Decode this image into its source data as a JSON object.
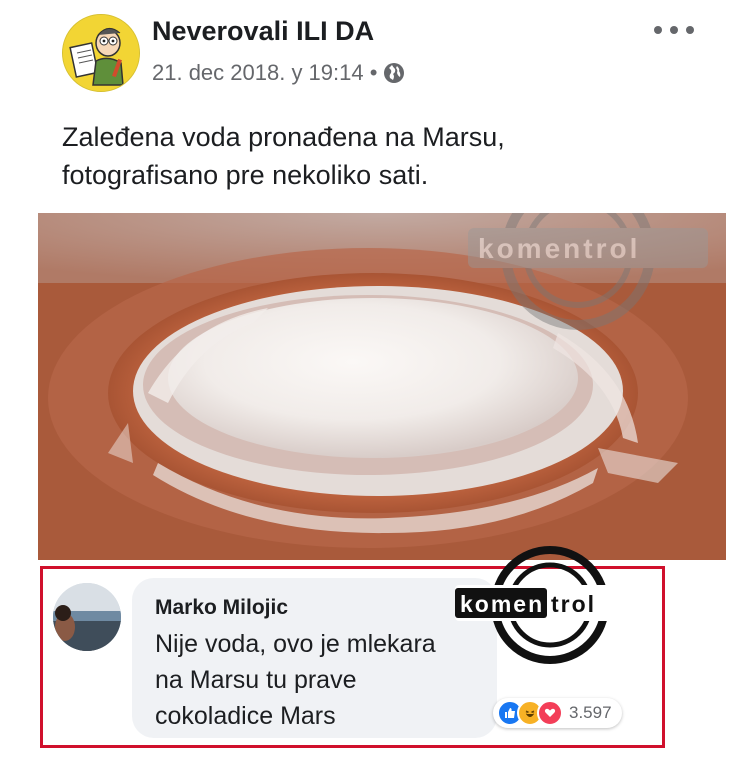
{
  "post": {
    "page_name": "Neverovali ILI DA",
    "timestamp": "21. dec 2018. у 19:14 •",
    "text_line1": "Zaleđena voda pronađena na Marsu,",
    "text_line2": "fotografisano pre nekoliko sati."
  },
  "watermark": {
    "brand": "komentrol"
  },
  "comment": {
    "author": "Marko Milojic",
    "line1": "Nije voda, ovo je mlekara",
    "line2": "na Marsu tu prave",
    "line3": "cokoladice Mars",
    "reaction_count": "3.597",
    "reactions": [
      "like-icon",
      "haha-icon",
      "love-icon"
    ]
  },
  "colors": {
    "highlight_border": "#d0102c",
    "like": "#1877f2",
    "haha": "#f7b125",
    "love": "#f33e58"
  }
}
